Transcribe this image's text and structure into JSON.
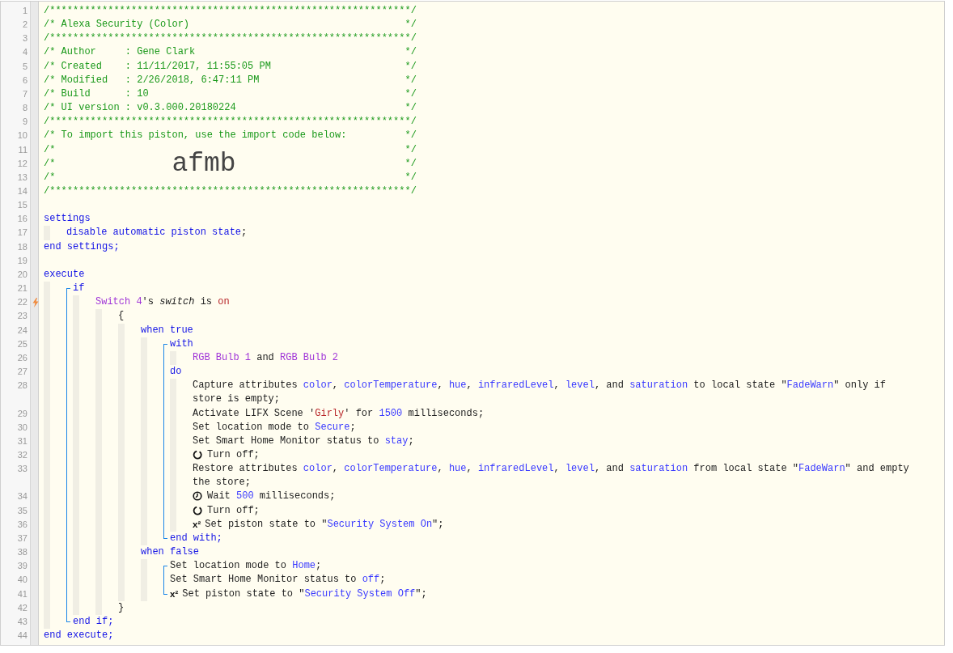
{
  "lines": [
    {
      "kind": "comment",
      "number": "1",
      "trigger": false,
      "text": "/**************************************************************/"
    },
    {
      "kind": "comment",
      "number": "2",
      "trigger": false,
      "text": "/* Alexa Security (Color)",
      "close": "*/"
    },
    {
      "kind": "comment",
      "number": "3",
      "trigger": false,
      "text": "/**************************************************************/"
    },
    {
      "kind": "comment",
      "number": "4",
      "trigger": false,
      "text": "/* Author     : Gene Clark",
      "close": "*/"
    },
    {
      "kind": "comment",
      "number": "5",
      "trigger": false,
      "text": "/* Created    : 11/11/2017, 11:55:05 PM",
      "close": "*/"
    },
    {
      "kind": "comment",
      "number": "6",
      "trigger": false,
      "text": "/* Modified   : 2/26/2018, 6:47:11 PM",
      "close": "*/"
    },
    {
      "kind": "comment",
      "number": "7",
      "trigger": false,
      "text": "/* Build      : 10",
      "close": "*/"
    },
    {
      "kind": "comment",
      "number": "8",
      "trigger": false,
      "text": "/* UI version : v0.3.000.20180224",
      "close": "*/"
    },
    {
      "kind": "comment",
      "number": "9",
      "trigger": false,
      "text": "/**************************************************************/"
    },
    {
      "kind": "comment",
      "number": "10",
      "trigger": false,
      "text": "/* To import this piston, use the import code below:",
      "close": "*/"
    },
    {
      "kind": "comment",
      "number": "11",
      "trigger": false,
      "text": "/*",
      "close": "*/"
    },
    {
      "kind": "comment",
      "number": "12",
      "trigger": false,
      "text": "/*",
      "import_code": "afmb",
      "close": "*/"
    },
    {
      "kind": "comment",
      "number": "13",
      "trigger": false,
      "text": "/*",
      "close": "*/"
    },
    {
      "kind": "comment",
      "number": "14",
      "trigger": false,
      "text": "/**************************************************************/"
    },
    {
      "kind": "line",
      "number": "15",
      "trigger": false
    },
    {
      "kind": "line",
      "number": "16",
      "trigger": false,
      "segments": [
        {
          "kind": "keyword",
          "text": "settings"
        }
      ],
      "children": [
        {
          "kind": "line",
          "number": "17",
          "trigger": false,
          "segments": [
            {
              "kind": "keyword",
              "text": "disable automatic piston state"
            },
            {
              "kind": "plain",
              "text": ";"
            }
          ]
        }
      ]
    },
    {
      "kind": "line",
      "number": "18",
      "trigger": false,
      "segments": [
        {
          "kind": "keyword",
          "text": "end settings;"
        }
      ]
    },
    {
      "kind": "line",
      "number": "19",
      "trigger": false
    },
    {
      "kind": "line",
      "number": "20",
      "trigger": false,
      "segments": [
        {
          "kind": "keyword",
          "text": "execute"
        }
      ],
      "children": [
        {
          "kind": "bracket",
          "lines": [
            {
              "kind": "line",
              "number": "21",
              "trigger": false,
              "segments": [
                {
                  "kind": "keyword",
                  "text": "if"
                }
              ],
              "children": [
                {
                  "kind": "line",
                  "number": "22",
                  "trigger": true,
                  "segments": [
                    {
                      "kind": "device",
                      "text": "Switch 4"
                    },
                    {
                      "kind": "plain",
                      "text": "'s "
                    },
                    {
                      "kind": "attribute",
                      "text": "switch"
                    },
                    {
                      "kind": "plain",
                      "text": " is "
                    },
                    {
                      "kind": "string",
                      "text": "on"
                    }
                  ],
                  "children": [
                    {
                      "kind": "line",
                      "number": "23",
                      "trigger": false,
                      "segments": [
                        {
                          "kind": "plain",
                          "text": "{"
                        }
                      ],
                      "children": [
                        {
                          "kind": "line",
                          "number": "24",
                          "trigger": false,
                          "segments": [
                            {
                              "kind": "keyword",
                              "text": "when true"
                            }
                          ],
                          "children": [
                            {
                              "kind": "bracket",
                              "lines": [
                                {
                                  "kind": "line",
                                  "number": "25",
                                  "trigger": false,
                                  "segments": [
                                    {
                                      "kind": "keyword",
                                      "text": "with"
                                    }
                                  ],
                                  "children": [
                                    {
                                      "kind": "line",
                                      "number": "26",
                                      "trigger": false,
                                      "segments": [
                                        {
                                          "kind": "device",
                                          "text": "RGB Bulb 1"
                                        },
                                        {
                                          "kind": "plain",
                                          "text": " and "
                                        },
                                        {
                                          "kind": "device",
                                          "text": "RGB Bulb 2"
                                        }
                                      ]
                                    }
                                  ]
                                },
                                {
                                  "kind": "line",
                                  "number": "27",
                                  "trigger": false,
                                  "segments": [
                                    {
                                      "kind": "keyword",
                                      "text": "do"
                                    }
                                  ],
                                  "children": [
                                    {
                                      "kind": "line",
                                      "number": "28",
                                      "trigger": false,
                                      "segments": [
                                        {
                                          "kind": "plain",
                                          "text": "Capture attributes "
                                        },
                                        {
                                          "kind": "value",
                                          "text": "color"
                                        },
                                        {
                                          "kind": "plain",
                                          "text": ", "
                                        },
                                        {
                                          "kind": "value",
                                          "text": "colorTemperature"
                                        },
                                        {
                                          "kind": "plain",
                                          "text": ", "
                                        },
                                        {
                                          "kind": "value",
                                          "text": "hue"
                                        },
                                        {
                                          "kind": "plain",
                                          "text": ", "
                                        },
                                        {
                                          "kind": "value",
                                          "text": "infraredLevel"
                                        },
                                        {
                                          "kind": "plain",
                                          "text": ", "
                                        },
                                        {
                                          "kind": "value",
                                          "text": "level"
                                        },
                                        {
                                          "kind": "plain",
                                          "text": ", and "
                                        },
                                        {
                                          "kind": "value",
                                          "text": "saturation"
                                        },
                                        {
                                          "kind": "plain",
                                          "text": " to local state \""
                                        },
                                        {
                                          "kind": "value",
                                          "text": "FadeWarn"
                                        },
                                        {
                                          "kind": "plain",
                                          "text": "\" only if store is empty;"
                                        }
                                      ]
                                    },
                                    {
                                      "kind": "line",
                                      "number": "29",
                                      "trigger": false,
                                      "segments": [
                                        {
                                          "kind": "plain",
                                          "text": "Activate LIFX Scene '"
                                        },
                                        {
                                          "kind": "string",
                                          "text": "Girly"
                                        },
                                        {
                                          "kind": "plain",
                                          "text": "' for "
                                        },
                                        {
                                          "kind": "value",
                                          "text": "1500"
                                        },
                                        {
                                          "kind": "plain",
                                          "text": " milliseconds;"
                                        }
                                      ]
                                    },
                                    {
                                      "kind": "line",
                                      "number": "30",
                                      "trigger": false,
                                      "segments": [
                                        {
                                          "kind": "plain",
                                          "text": "Set location mode to "
                                        },
                                        {
                                          "kind": "value",
                                          "text": "Secure"
                                        },
                                        {
                                          "kind": "plain",
                                          "text": ";"
                                        }
                                      ]
                                    },
                                    {
                                      "kind": "line",
                                      "number": "31",
                                      "trigger": false,
                                      "segments": [
                                        {
                                          "kind": "plain",
                                          "text": "Set Smart Home Monitor status to "
                                        },
                                        {
                                          "kind": "value",
                                          "text": "stay"
                                        },
                                        {
                                          "kind": "plain",
                                          "text": ";"
                                        }
                                      ]
                                    },
                                    {
                                      "kind": "action",
                                      "number": "32",
                                      "trigger": false,
                                      "segments": [
                                        {
                                          "kind": "plain",
                                          "text": "Turn off;"
                                        }
                                      ]
                                    },
                                    {
                                      "kind": "line",
                                      "number": "33",
                                      "trigger": false,
                                      "segments": [
                                        {
                                          "kind": "plain",
                                          "text": "Restore attributes "
                                        },
                                        {
                                          "kind": "value",
                                          "text": "color"
                                        },
                                        {
                                          "kind": "plain",
                                          "text": ", "
                                        },
                                        {
                                          "kind": "value",
                                          "text": "colorTemperature"
                                        },
                                        {
                                          "kind": "plain",
                                          "text": ", "
                                        },
                                        {
                                          "kind": "value",
                                          "text": "hue"
                                        },
                                        {
                                          "kind": "plain",
                                          "text": ", "
                                        },
                                        {
                                          "kind": "value",
                                          "text": "infraredLevel"
                                        },
                                        {
                                          "kind": "plain",
                                          "text": ", "
                                        },
                                        {
                                          "kind": "value",
                                          "text": "level"
                                        },
                                        {
                                          "kind": "plain",
                                          "text": ", and "
                                        },
                                        {
                                          "kind": "value",
                                          "text": "saturation"
                                        },
                                        {
                                          "kind": "plain",
                                          "text": " from local state \""
                                        },
                                        {
                                          "kind": "value",
                                          "text": "FadeWarn"
                                        },
                                        {
                                          "kind": "plain",
                                          "text": "\" and empty the store;"
                                        }
                                      ]
                                    },
                                    {
                                      "kind": "wait",
                                      "number": "34",
                                      "trigger": false,
                                      "segments": [
                                        {
                                          "kind": "plain",
                                          "text": "Wait "
                                        },
                                        {
                                          "kind": "value",
                                          "text": "500"
                                        },
                                        {
                                          "kind": "plain",
                                          "text": " milliseconds;"
                                        }
                                      ]
                                    },
                                    {
                                      "kind": "action",
                                      "number": "35",
                                      "trigger": false,
                                      "segments": [
                                        {
                                          "kind": "plain",
                                          "text": "Turn off;"
                                        }
                                      ]
                                    },
                                    {
                                      "kind": "set",
                                      "number": "36",
                                      "trigger": false,
                                      "badge": "x²",
                                      "segments": [
                                        {
                                          "kind": "plain",
                                          "text": "Set piston state to \""
                                        },
                                        {
                                          "kind": "value",
                                          "text": "Security System On"
                                        },
                                        {
                                          "kind": "plain",
                                          "text": "\";"
                                        }
                                      ]
                                    }
                                  ]
                                },
                                {
                                  "kind": "line",
                                  "number": "37",
                                  "trigger": false,
                                  "segments": [
                                    {
                                      "kind": "keyword",
                                      "text": "end with;"
                                    }
                                  ]
                                }
                              ]
                            }
                          ]
                        },
                        {
                          "kind": "line",
                          "number": "38",
                          "trigger": false,
                          "segments": [
                            {
                              "kind": "keyword",
                              "text": "when false"
                            }
                          ],
                          "children": [
                            {
                              "kind": "bracket",
                              "lines": [
                                {
                                  "kind": "line",
                                  "number": "39",
                                  "trigger": false,
                                  "segments": [
                                    {
                                      "kind": "plain",
                                      "text": "Set location mode to "
                                    },
                                    {
                                      "kind": "value",
                                      "text": "Home"
                                    },
                                    {
                                      "kind": "plain",
                                      "text": ";"
                                    }
                                  ]
                                },
                                {
                                  "kind": "line",
                                  "number": "40",
                                  "trigger": false,
                                  "segments": [
                                    {
                                      "kind": "plain",
                                      "text": "Set Smart Home Monitor status to "
                                    },
                                    {
                                      "kind": "value",
                                      "text": "off"
                                    },
                                    {
                                      "kind": "plain",
                                      "text": ";"
                                    }
                                  ]
                                },
                                {
                                  "kind": "set",
                                  "number": "41",
                                  "trigger": false,
                                  "badge": "x²",
                                  "segments": [
                                    {
                                      "kind": "plain",
                                      "text": "Set piston state to \""
                                    },
                                    {
                                      "kind": "value",
                                      "text": "Security System Off"
                                    },
                                    {
                                      "kind": "plain",
                                      "text": "\";"
                                    }
                                  ]
                                }
                              ]
                            }
                          ]
                        }
                      ]
                    },
                    {
                      "kind": "line",
                      "number": "42",
                      "trigger": false,
                      "segments": [
                        {
                          "kind": "plain",
                          "text": "}"
                        }
                      ]
                    }
                  ]
                }
              ]
            },
            {
              "kind": "line",
              "number": "43",
              "trigger": false,
              "segments": [
                {
                  "kind": "keyword",
                  "text": "end if;"
                }
              ]
            }
          ]
        }
      ]
    },
    {
      "kind": "line",
      "number": "44",
      "trigger": false,
      "segments": [
        {
          "kind": "keyword",
          "text": "end execute;"
        }
      ]
    }
  ]
}
